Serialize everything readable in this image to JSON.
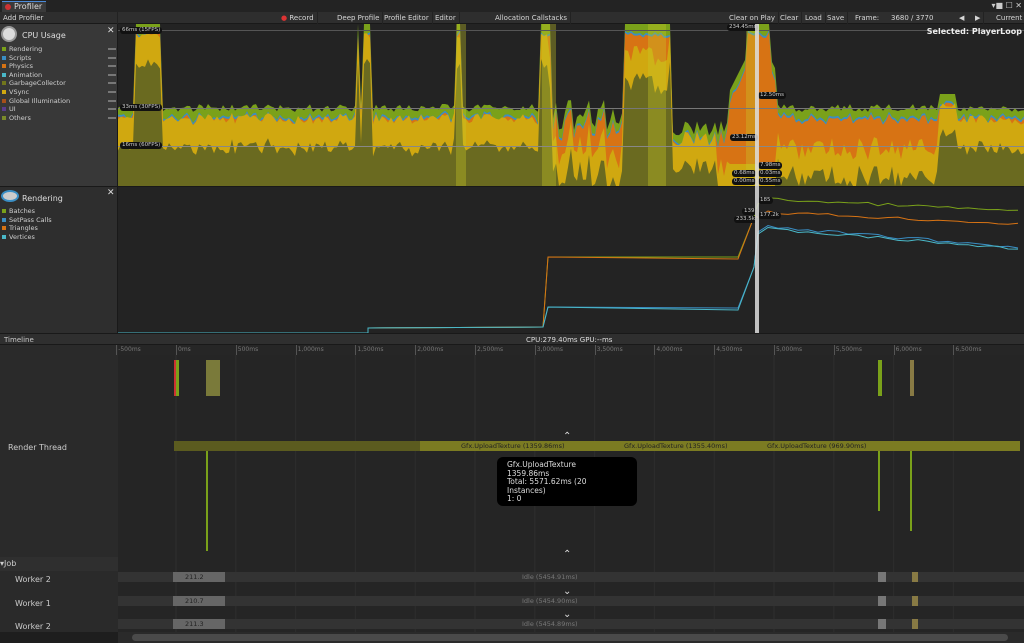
{
  "window": {
    "tab_title": "Profiler",
    "controls": "▾■ ☐ ✕"
  },
  "toolbar": {
    "add_profiler": "Add Profiler",
    "record": "Record",
    "deep_profile": "Deep Profile",
    "profile_editor": "Profile Editor",
    "editor": "Editor",
    "allocation_callstacks": "Allocation Callstacks",
    "clear_on_play": "Clear on Play",
    "clear": "Clear",
    "load": "Load",
    "save": "Save",
    "frame_label": "Frame:",
    "frame_value": "3680 / 3770",
    "prev": "◀",
    "next": "▶",
    "current": "Current"
  },
  "cpu": {
    "title": "CPU Usage",
    "selected": "Selected: PlayerLoop",
    "legend": [
      {
        "label": "Rendering",
        "color": "#7aa11a"
      },
      {
        "label": "Scripts",
        "color": "#3a8ec4"
      },
      {
        "label": "Physics",
        "color": "#d77314"
      },
      {
        "label": "Animation",
        "color": "#4ab8c8"
      },
      {
        "label": "GarbageCollector",
        "color": "#71761c"
      },
      {
        "label": "VSync",
        "color": "#d0a810"
      },
      {
        "label": "Global Illumination",
        "color": "#a6501a"
      },
      {
        "label": "UI",
        "color": "#5a3c8e"
      },
      {
        "label": "Others",
        "color": "#7a8a2a"
      }
    ],
    "guides": {
      "g66": "66ms (15FPS)",
      "g33": "33ms (30FPS)",
      "g16": "16ms (60FPS)"
    },
    "values": {
      "top": "234.45ms",
      "v1": "12.50ms",
      "v2": "23.12ms",
      "v3": "7.98ms",
      "v4": "0.68ms",
      "v5": "0.03ms",
      "v6": "0.00ms",
      "v7": "0.55ms"
    }
  },
  "rendering": {
    "title": "Rendering",
    "legend": [
      {
        "label": "Batches",
        "color": "#7aa11a"
      },
      {
        "label": "SetPass Calls",
        "color": "#3a8ec4"
      },
      {
        "label": "Triangles",
        "color": "#d77314"
      },
      {
        "label": "Vertices",
        "color": "#4ab8c8"
      }
    ],
    "values": {
      "v1": "185",
      "v2": "139",
      "v3": "233.5k",
      "v4": "177.2k"
    }
  },
  "timeline": {
    "mode": "Timeline",
    "summary": "CPU:279.40ms  GPU:--ms",
    "ticks": [
      "-500ms",
      "0ms",
      "500ms",
      "1,000ms",
      "1,500ms",
      "2,000ms",
      "2,500ms",
      "3,000ms",
      "3,500ms",
      "4,000ms",
      "4,500ms",
      "5,000ms",
      "5,500ms",
      "6,000ms",
      "6,500ms"
    ],
    "render_thread": "Render Thread",
    "bars": [
      "Gfx.UploadTexture (1359.86ms)",
      "Gfx.UploadTexture (1355.40ms)",
      "Gfx.UploadTexture (969.90ms)"
    ],
    "tooltip": {
      "name": "Gfx.UploadTexture",
      "time": "1359.86ms",
      "total": "Total: 5571.62ms (20 Instances)",
      "line": "1: 0"
    },
    "job": "Job",
    "workers": [
      {
        "label": "Worker 2",
        "short": "211.2",
        "idle": "Idle (5454.91ms)"
      },
      {
        "label": "Worker 1",
        "short": "210.7",
        "idle": "Idle (5454.90ms)"
      },
      {
        "label": "Worker 2",
        "short": "211.3",
        "idle": "Idle (5454.89ms)"
      }
    ]
  }
}
